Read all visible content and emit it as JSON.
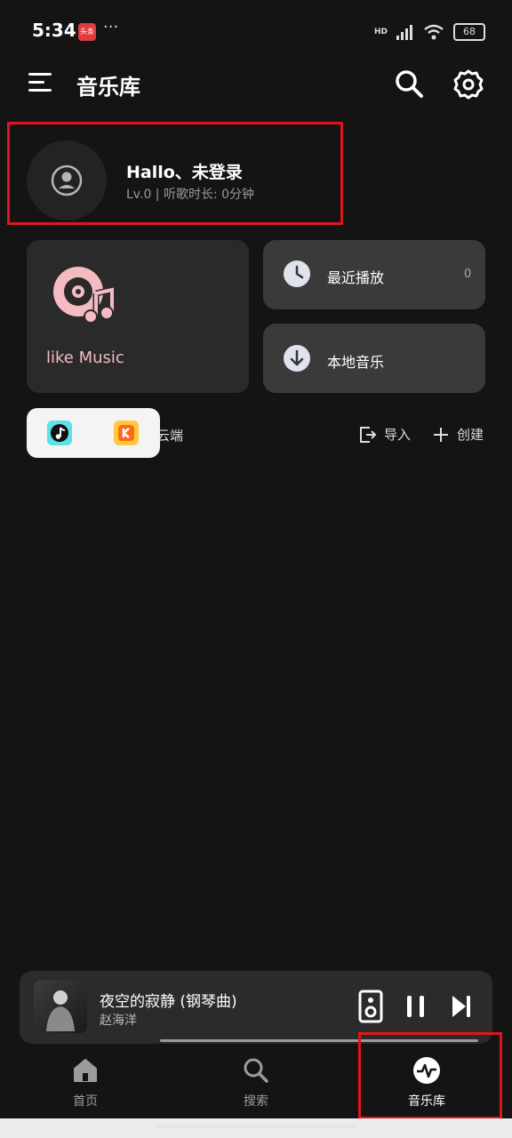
{
  "status_bar": {
    "time": "5:34",
    "app_badge": "头条",
    "dots": "···",
    "battery": "68",
    "network": "HD"
  },
  "header": {
    "title": "音乐库"
  },
  "profile": {
    "name": "Hallo、未登录",
    "level_info": "Lv.0 | 听歌时长: 0分钟"
  },
  "cards": {
    "like_music": "like Music",
    "recent_play": "最近播放",
    "recent_count": "0",
    "local_music": "本地音乐"
  },
  "playlist_actions": {
    "cloud_partial": "云端",
    "import": "导入",
    "create": "创建"
  },
  "mini_player": {
    "title": "夜空的寂静 (钢琴曲)",
    "artist": "赵海洋"
  },
  "bottom_nav": [
    {
      "label": "首页"
    },
    {
      "label": "搜索"
    },
    {
      "label": "音乐库"
    }
  ],
  "colors": {
    "accent_highlight": "#e0141d",
    "like_pink": "#f3bcc2",
    "background": "#141414"
  }
}
